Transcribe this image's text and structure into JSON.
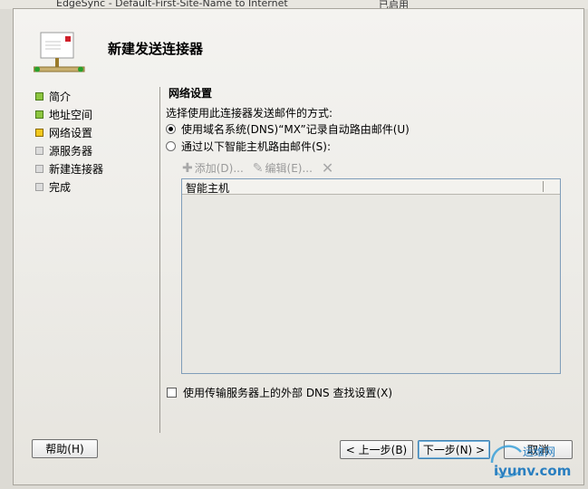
{
  "background_window": {
    "row_text": "EdgeSync - Default-First-Site-Name to Internet",
    "status_text": "已启用"
  },
  "dialog": {
    "title": "新建发送连接器"
  },
  "nav": {
    "items": [
      {
        "label": "简介",
        "state": "done"
      },
      {
        "label": "地址空间",
        "state": "done"
      },
      {
        "label": "网络设置",
        "state": "current"
      },
      {
        "label": "源服务器",
        "state": "pending"
      },
      {
        "label": "新建连接器",
        "state": "pending"
      },
      {
        "label": "完成",
        "state": "pending"
      }
    ]
  },
  "network": {
    "section_title": "网络设置",
    "method_label": "选择使用此连接器发送邮件的方式:",
    "radio_dns": "使用域名系统(DNS)“MX”记录自动路由邮件(U)",
    "radio_smarthost": "通过以下智能主机路由邮件(S):",
    "toolbar": {
      "add": "添加(D)...",
      "edit": "编辑(E)...",
      "delete_icon": "delete-icon"
    },
    "list_header": "智能主机",
    "checkbox_label": "使用传输服务器上的外部 DNS 查找设置(X)"
  },
  "buttons": {
    "help": "帮助(H)",
    "back": "< 上一步(B)",
    "next": "下一步(N) >",
    "cancel": "取消"
  },
  "watermark": {
    "line1": "运维网",
    "line2": "iyunv.com"
  },
  "colors": {
    "done": "#8cc63f",
    "current": "#f2c81c",
    "pending": "#dcdcdc",
    "default_button_border": "#3c7fb1"
  }
}
